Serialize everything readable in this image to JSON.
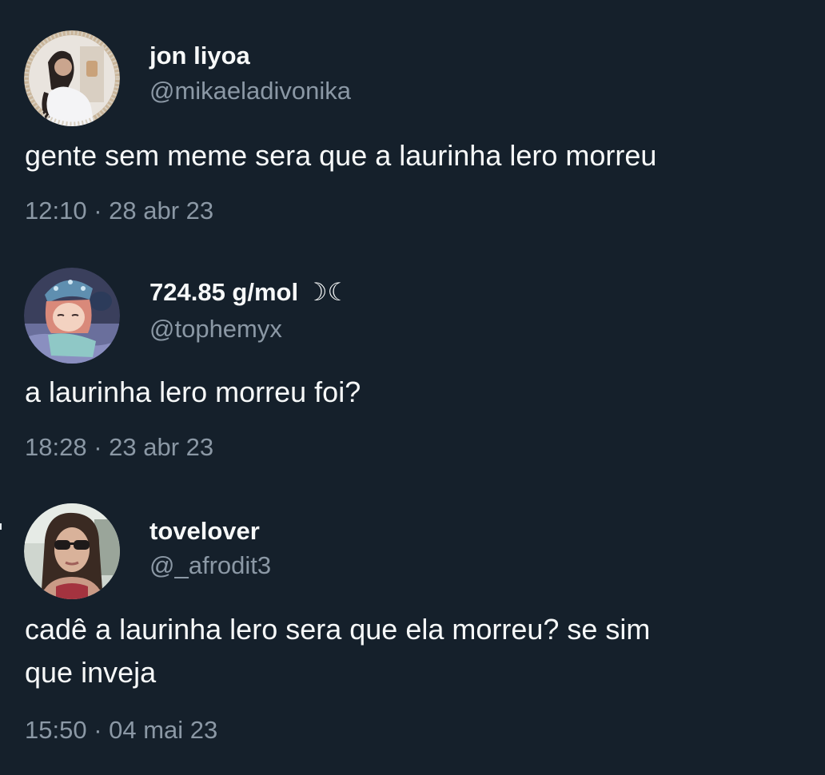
{
  "tweets": [
    {
      "display_name": "jon liyoa",
      "handle": "@mikaeladivonika",
      "text": "gente sem meme sera que a laurinha lero morreu",
      "timestamp": "12:10 · 28 abr 23",
      "avatar_icon": "avatar-photo-woman-mirror-selfie"
    },
    {
      "display_name": "724.85 g/mol ☽☾",
      "handle": "@tophemyx",
      "text": "a laurinha lero morreu foi?",
      "timestamp": "18:28 · 23 abr 23",
      "avatar_icon": "avatar-anime-girl-sleeping-cap"
    },
    {
      "display_name": "tovelover",
      "handle": "@_afrodit3",
      "text": "cadê a laurinha lero sera que ela morreu? se sim\nque inveja",
      "timestamp": "15:50 · 04 mai 23",
      "avatar_icon": "avatar-photo-woman-sunglasses"
    }
  ],
  "colors": {
    "background": "#15202b",
    "primary_text": "#f7f9f9",
    "secondary_text": "#8b98a5"
  }
}
